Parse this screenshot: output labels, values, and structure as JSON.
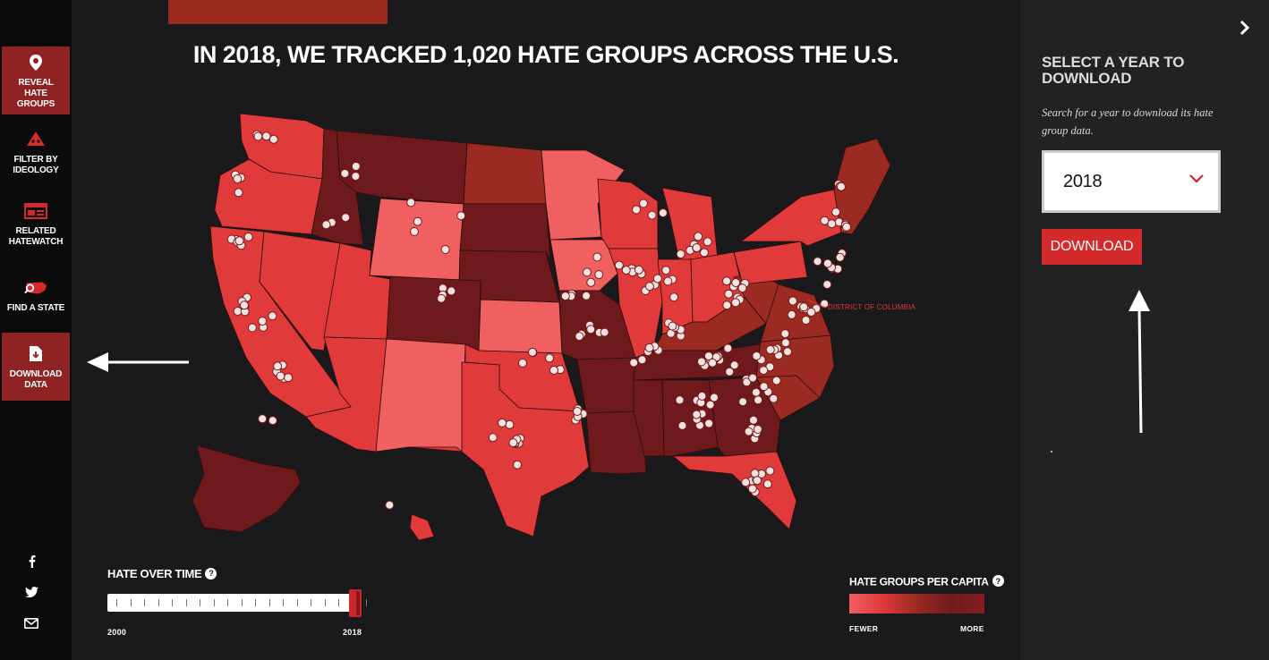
{
  "nav": {
    "items": [
      {
        "label": "REVEAL HATE GROUPS",
        "icon": "map-pin-icon"
      },
      {
        "label": "FILTER BY IDEOLOGY",
        "icon": "ideology-mask-icon"
      },
      {
        "label": "RELATED HATEWATCH",
        "icon": "newspaper-icon"
      },
      {
        "label": "FIND A STATE",
        "icon": "us-map-search-icon"
      },
      {
        "label": "DOWNLOAD DATA",
        "icon": "download-file-icon"
      }
    ],
    "active": "DOWNLOAD DATA",
    "social": [
      "facebook-icon",
      "twitter-icon",
      "email-icon"
    ]
  },
  "headline": "IN 2018, WE TRACKED 1,020 HATE GROUPS ACROSS THE U.S.",
  "map": {
    "callout": "DISTRICT OF COLUMBIA"
  },
  "timeline": {
    "title": "HATE OVER TIME",
    "help": "?",
    "start_label": "2000",
    "end_label": "2018",
    "selected_year": 2018
  },
  "legend": {
    "title": "HATE GROUPS PER CAPITA",
    "help": "?",
    "low_label": "FEWER",
    "high_label": "MORE",
    "colors": [
      "#f06061",
      "#e03a3b",
      "#9a2a22",
      "#6e1a1c"
    ]
  },
  "panel": {
    "heading": "SELECT A YEAR TO DOWNLOAD",
    "description": "Search for a year to download its hate group data.",
    "selected_year": "2018",
    "download_label": "DOWNLOAD"
  },
  "colors": {
    "accent": "#d42a2c",
    "nav_active": "#8f2223",
    "background": "#1a1a1d"
  }
}
